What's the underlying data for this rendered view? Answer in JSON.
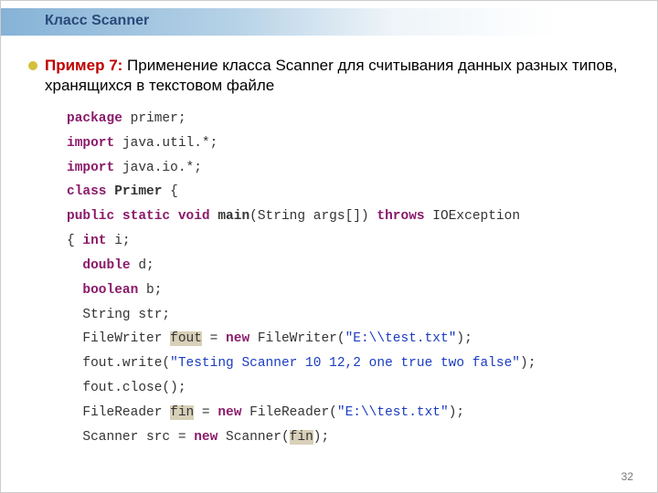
{
  "title": "Класс Scanner",
  "example_label": "Пример 7:",
  "description": "Применение класса Scanner для считывания данных разных типов, хранящихся в текстовом файле",
  "page_number": "32",
  "code": {
    "l1_kw": "package",
    "l1_rest": " primer;",
    "l2_kw": "import",
    "l2_rest": " java.util.*;",
    "l3_kw": "import",
    "l3_rest": " java.io.*;",
    "l4_kw": "class",
    "l4_name": "Primer",
    "l4_brace": " {",
    "l5_mods": "public static void",
    "l5_main": "main",
    "l5_args": "(String args[]) ",
    "l5_throws": "throws",
    "l5_ex": " IOException",
    "l6_open": "{ ",
    "l6_kw": "int",
    "l6_rest": " i;",
    "l7_kw": "double",
    "l7_rest": " d;",
    "l8_kw": "boolean",
    "l8_rest": " b;",
    "l9": "String str;",
    "l10_a": "FileWriter ",
    "l10_v": "fout",
    "l10_b": " = ",
    "l10_new": "new",
    "l10_c": " FileWriter(",
    "l10_str": "\"E:\\\\test.txt\"",
    "l10_d": ");",
    "l11_a": "fout.write(",
    "l11_str": "\"Testing Scanner 10 12,2 one true two false\"",
    "l11_b": ");",
    "l12": "fout.close();",
    "l13_a": "FileReader ",
    "l13_v": "fin",
    "l13_b": " = ",
    "l13_new": "new",
    "l13_c": " FileReader(",
    "l13_str": "\"E:\\\\test.txt\"",
    "l13_d": ");",
    "l14_a": "Scanner src = ",
    "l14_new": "new",
    "l14_b": " Scanner(",
    "l14_v": "fin",
    "l14_c": ");"
  }
}
